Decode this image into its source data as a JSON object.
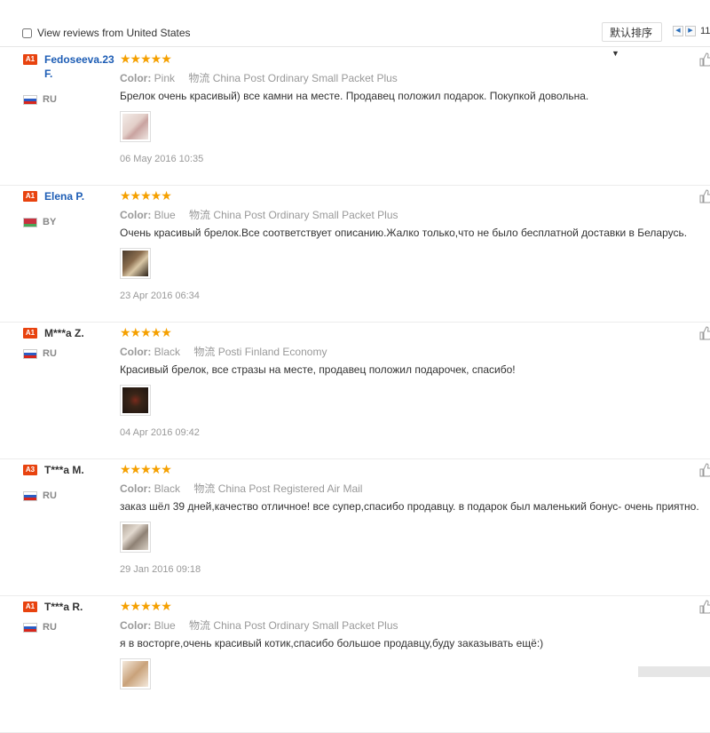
{
  "topbar": {
    "filter_label": "View reviews from United States",
    "sort_label": "默认排序",
    "page_number": "11"
  },
  "reviews": [
    {
      "badge": "A1",
      "user": "Fedoseeva.23 F.",
      "user_is_link": true,
      "country": "RU",
      "stars": "★★★★★",
      "color_label": "Color:",
      "color_value": "Pink",
      "shipping_label": "物流",
      "shipping_value": "China Post Ordinary Small Packet Plus",
      "text": "Брелок очень красивый) все камни на месте. Продавец положил подарок. Покупкой довольна.",
      "date": "06 May 2016 10:35"
    },
    {
      "badge": "A1",
      "user": "Elena P.",
      "user_is_link": true,
      "country": "BY",
      "stars": "★★★★★",
      "color_label": "Color:",
      "color_value": "Blue",
      "shipping_label": "物流",
      "shipping_value": "China Post Ordinary Small Packet Plus",
      "text": "Очень красивый брелок.Все соответствует описанию.Жалко только,что не было бесплатной доставки в Беларусь.",
      "date": "23 Apr 2016 06:34"
    },
    {
      "badge": "A1",
      "user": "M***a Z.",
      "user_is_link": false,
      "country": "RU",
      "stars": "★★★★★",
      "color_label": "Color:",
      "color_value": "Black",
      "shipping_label": "物流",
      "shipping_value": "Posti Finland Economy",
      "text": "Красивый брелок, все стразы на месте, продавец положил подарочек, спасибо!",
      "date": "04 Apr 2016 09:42"
    },
    {
      "badge": "A3",
      "user": "T***a M.",
      "user_is_link": false,
      "country": "RU",
      "stars": "★★★★★",
      "color_label": "Color:",
      "color_value": "Black",
      "shipping_label": "物流",
      "shipping_value": "China Post Registered Air Mail",
      "text": "заказ шёл 39 дней,качество отличное! все супер,спасибо продавцу. в подарок был маленький бонус- очень приятно.",
      "date": "29 Jan 2016 09:18"
    },
    {
      "badge": "A1",
      "user": "T***a R.",
      "user_is_link": false,
      "country": "RU",
      "stars": "★★★★★",
      "color_label": "Color:",
      "color_value": "Blue",
      "shipping_label": "物流",
      "shipping_value": "China Post Ordinary Small Packet Plus",
      "text": "я в восторге,очень красивый котик,спасибо большое продавцу,буду заказывать ещё:)",
      "date": ""
    }
  ],
  "colors": {
    "badge": "#e8430f",
    "star": "#f5a000",
    "link": "#1d5db5",
    "muted": "#999999"
  }
}
